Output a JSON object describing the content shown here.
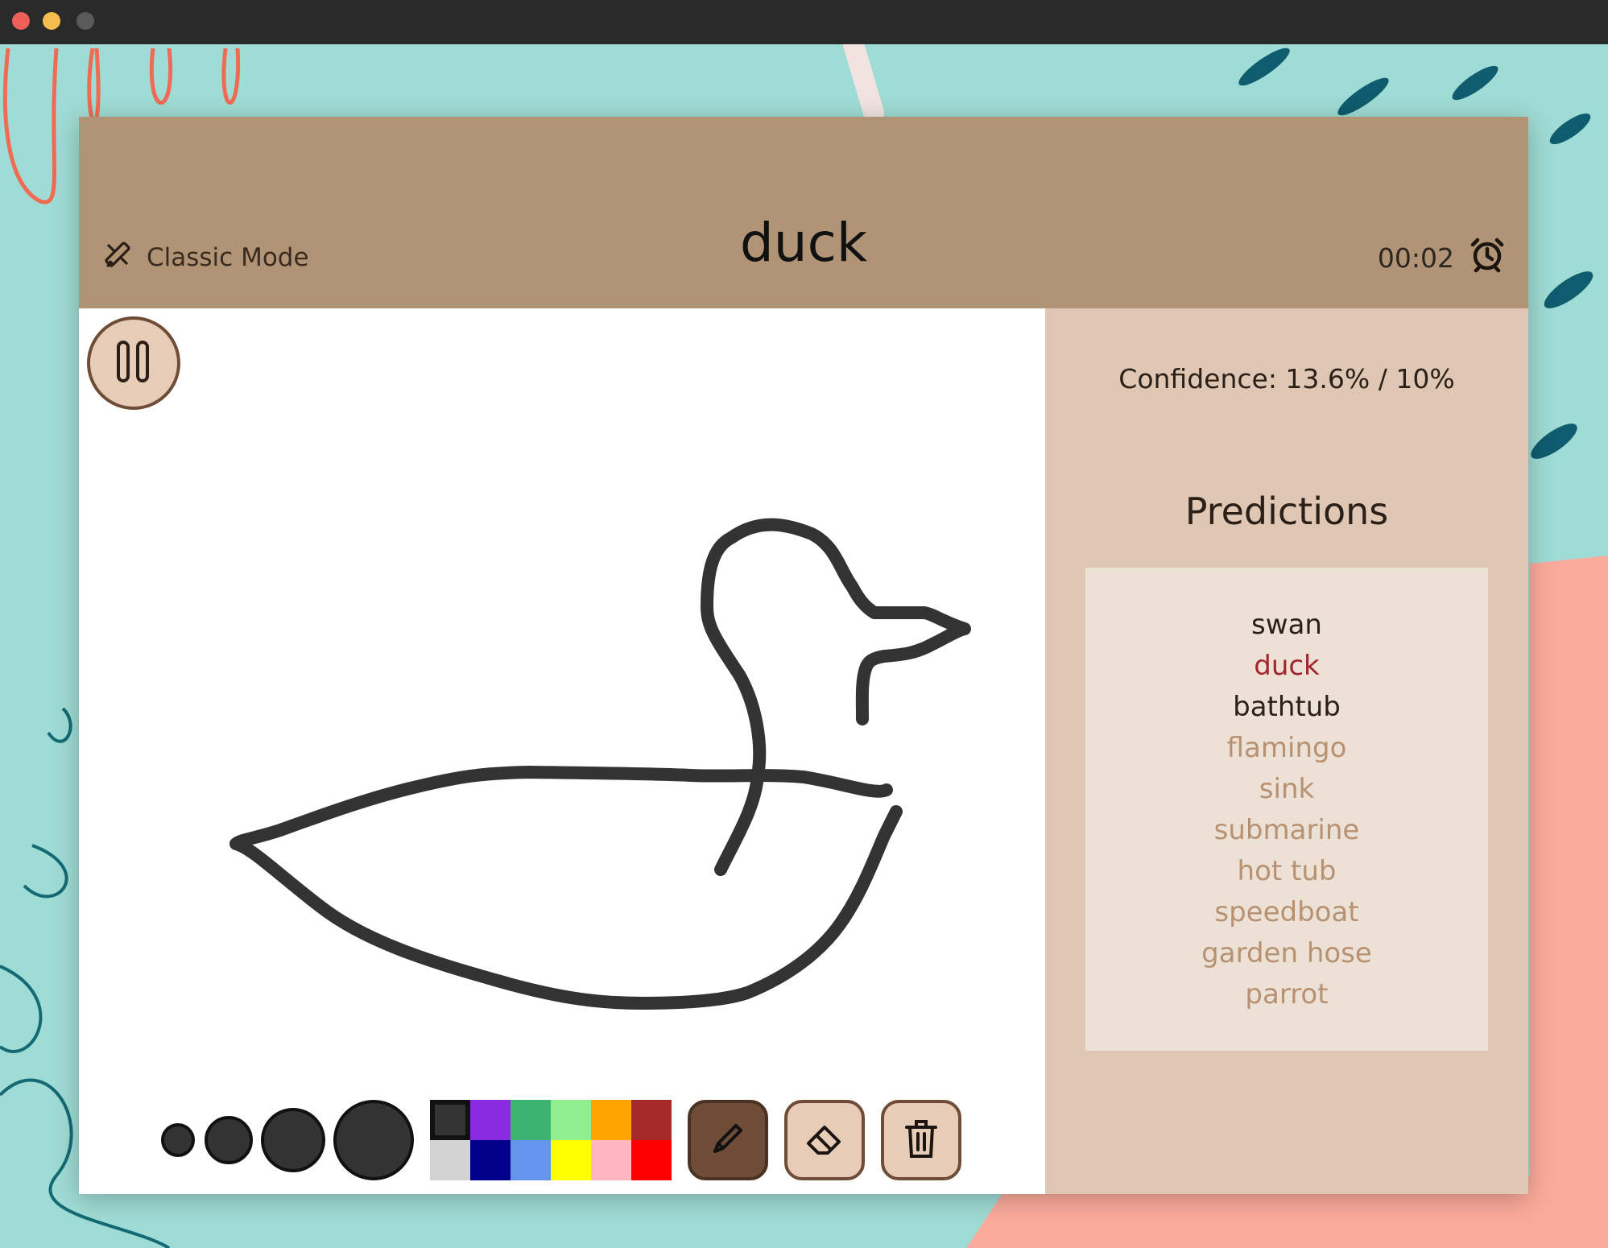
{
  "window": {
    "title": ""
  },
  "header": {
    "mode_label": "Classic Mode",
    "target_word": "duck",
    "timer": "00:02"
  },
  "toolbar": {
    "brush_sizes": [
      "small",
      "medium",
      "large",
      "extra-large"
    ],
    "colors": [
      "#333333",
      "#8a2be2",
      "#3cb371",
      "#90ee90",
      "#ffa500",
      "#a52a2a",
      "#d3d3d3",
      "#00008b",
      "#6495ed",
      "#ffff00",
      "#ffb6c1",
      "#ff0000"
    ],
    "selected_color": "#333333",
    "active_tool": "pencil"
  },
  "sidebar": {
    "confidence": "Confidence: 13.6% / 10%",
    "predictions_title": "Predictions",
    "predictions": [
      {
        "label": "swan",
        "color": "#2a2018"
      },
      {
        "label": "duck",
        "color": "#a3242c"
      },
      {
        "label": "bathtub",
        "color": "#2a2018"
      },
      {
        "label": "flamingo",
        "color": "#b79272"
      },
      {
        "label": "sink",
        "color": "#b79272"
      },
      {
        "label": "submarine",
        "color": "#b79272"
      },
      {
        "label": "hot tub",
        "color": "#b79272"
      },
      {
        "label": "speedboat",
        "color": "#b79272"
      },
      {
        "label": "garden hose",
        "color": "#b79272"
      },
      {
        "label": "parrot",
        "color": "#b79272"
      }
    ]
  }
}
